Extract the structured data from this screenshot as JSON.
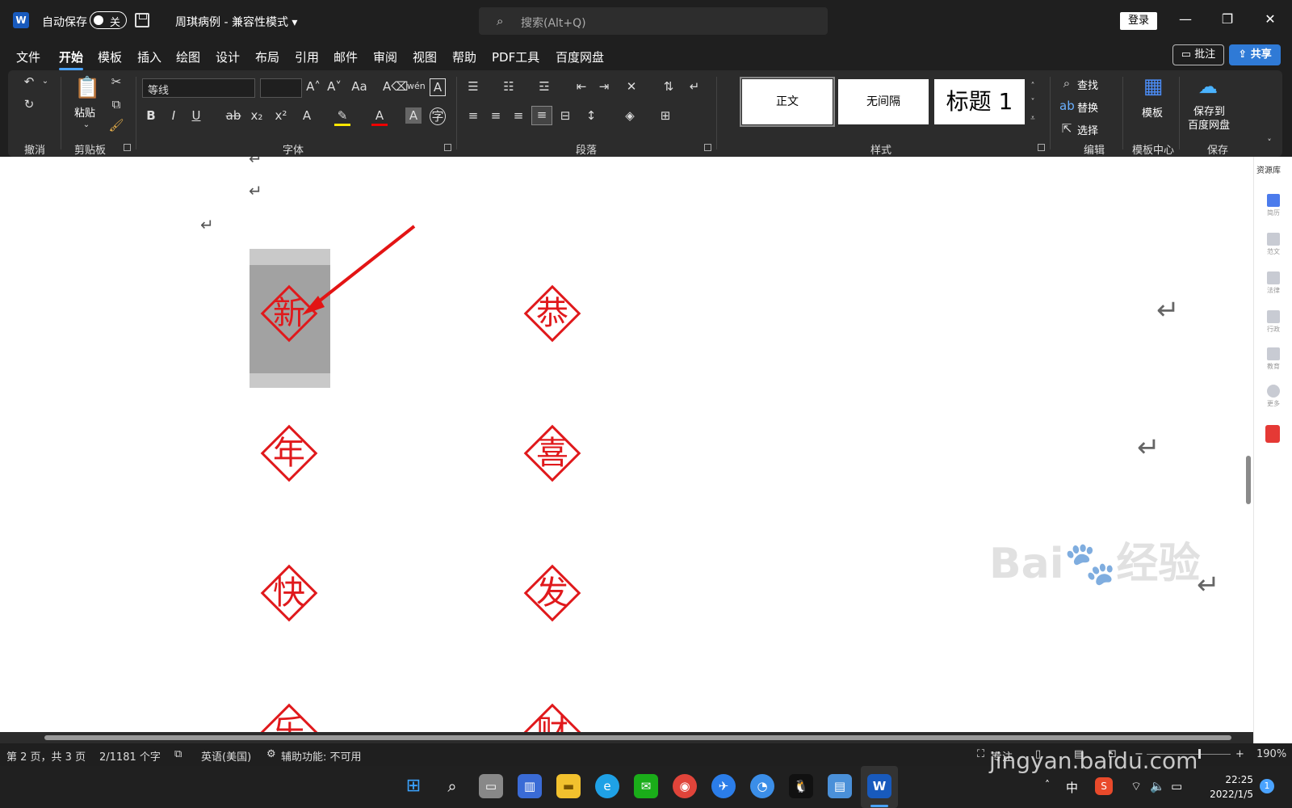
{
  "titlebar": {
    "autosave_label": "自动保存",
    "toggle_state": "关",
    "doc_title": "周琪病例 - 兼容性模式 ▾",
    "search_placeholder": "搜索(Alt+Q)",
    "login": "登录"
  },
  "menu": {
    "tabs": [
      "文件",
      "开始",
      "模板",
      "插入",
      "绘图",
      "设计",
      "布局",
      "引用",
      "邮件",
      "审阅",
      "视图",
      "帮助",
      "PDF工具",
      "百度网盘"
    ],
    "active_tab": "开始",
    "comment": "批注",
    "share": "共享"
  },
  "ribbon": {
    "groups": [
      "撤消",
      "剪贴板",
      "字体",
      "段落",
      "样式",
      "编辑",
      "模板中心",
      "保存"
    ],
    "paste": "粘贴",
    "font_name": "等线",
    "styles": [
      "正文",
      "无间隔",
      "标题 1"
    ],
    "edit_items": [
      "查找",
      "替换",
      "选择"
    ],
    "template": "模板",
    "save_to": "保存到",
    "baidu_disk": "百度网盘"
  },
  "document": {
    "left_column": [
      "新",
      "年",
      "快",
      "乐"
    ],
    "right_column": [
      "恭",
      "喜",
      "发",
      "财"
    ],
    "pilcrow": "↵"
  },
  "sidepane": {
    "header": "资源库",
    "items": [
      "简历",
      "范文",
      "法律",
      "行政",
      "教育",
      "更多"
    ]
  },
  "statusbar": {
    "page": "第 2 页，共 3 页",
    "words": "2/1181 个字",
    "language": "英语(美国)",
    "accessibility": "辅助功能: 不可用",
    "focus": "专注",
    "zoom": "190%"
  },
  "taskbar": {
    "ime": "中",
    "time": "22:25",
    "date": "2022/1/5",
    "notifications": "1"
  },
  "watermark": {
    "brand": "Bai",
    "brand2": "经验",
    "url": "jingyan.baidu.com"
  },
  "colors": {
    "accent": "#4aa3ff",
    "seal_red": "#e0191c",
    "selection": "#a2a2a2"
  }
}
